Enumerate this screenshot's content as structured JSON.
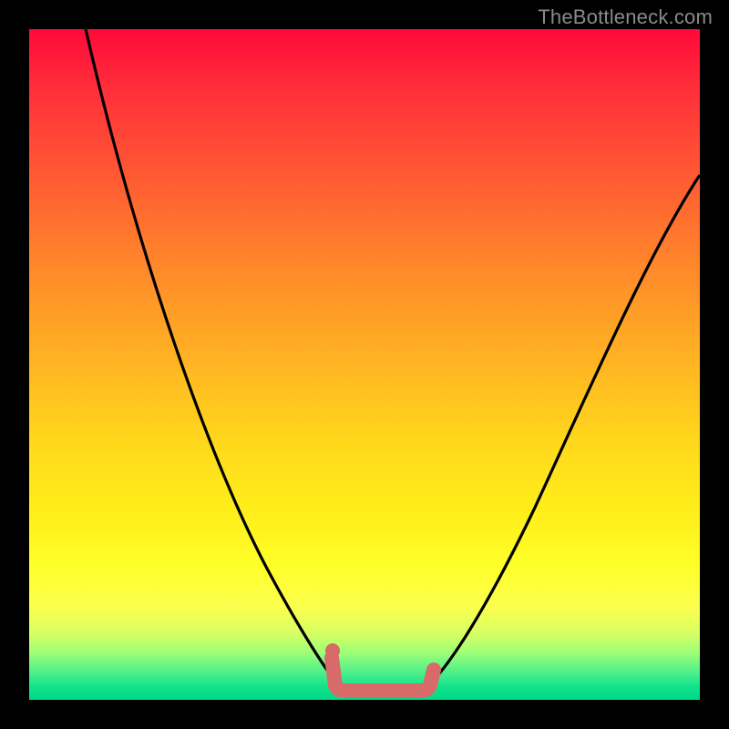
{
  "watermark": "TheBottleneck.com",
  "colors": {
    "frame_bg": "#000000",
    "curve_stroke": "#000000",
    "bracket_stroke": "#d86a6a",
    "watermark_text": "#8a8a8a",
    "gradient_stops": [
      "#ff0a3a",
      "#ff2b3a",
      "#ff5a33",
      "#ff8a2a",
      "#ffb522",
      "#ffd91c",
      "#ffee1a",
      "#ffff28",
      "#fcff4e",
      "#d8ff62",
      "#9dff78",
      "#4cef8a",
      "#12e38b",
      "#00d988"
    ]
  },
  "chart_data": {
    "type": "line",
    "title": "",
    "xlabel": "",
    "ylabel": "",
    "xlim": [
      0,
      100
    ],
    "ylim": [
      0,
      100
    ],
    "grid": false,
    "legend": false,
    "notes": "No axes or tick labels are shown; values are read as relative percentages of the plot area.",
    "series": [
      {
        "name": "left_curve",
        "x": [
          8,
          14,
          20,
          26,
          32,
          38,
          42,
          46
        ],
        "y": [
          100,
          75,
          52,
          34,
          20,
          10,
          4,
          2
        ]
      },
      {
        "name": "right_curve",
        "x": [
          60,
          64,
          70,
          76,
          82,
          90,
          100
        ],
        "y": [
          2,
          5,
          13,
          29,
          46,
          64,
          78
        ]
      },
      {
        "name": "flat_minimum_segment",
        "x": [
          45,
          48,
          54,
          58,
          60
        ],
        "y": [
          6,
          1.4,
          1.4,
          1.4,
          5
        ]
      }
    ],
    "annotations": [
      {
        "type": "marker",
        "x": 45,
        "y": 7.3,
        "label": "dot"
      }
    ]
  }
}
